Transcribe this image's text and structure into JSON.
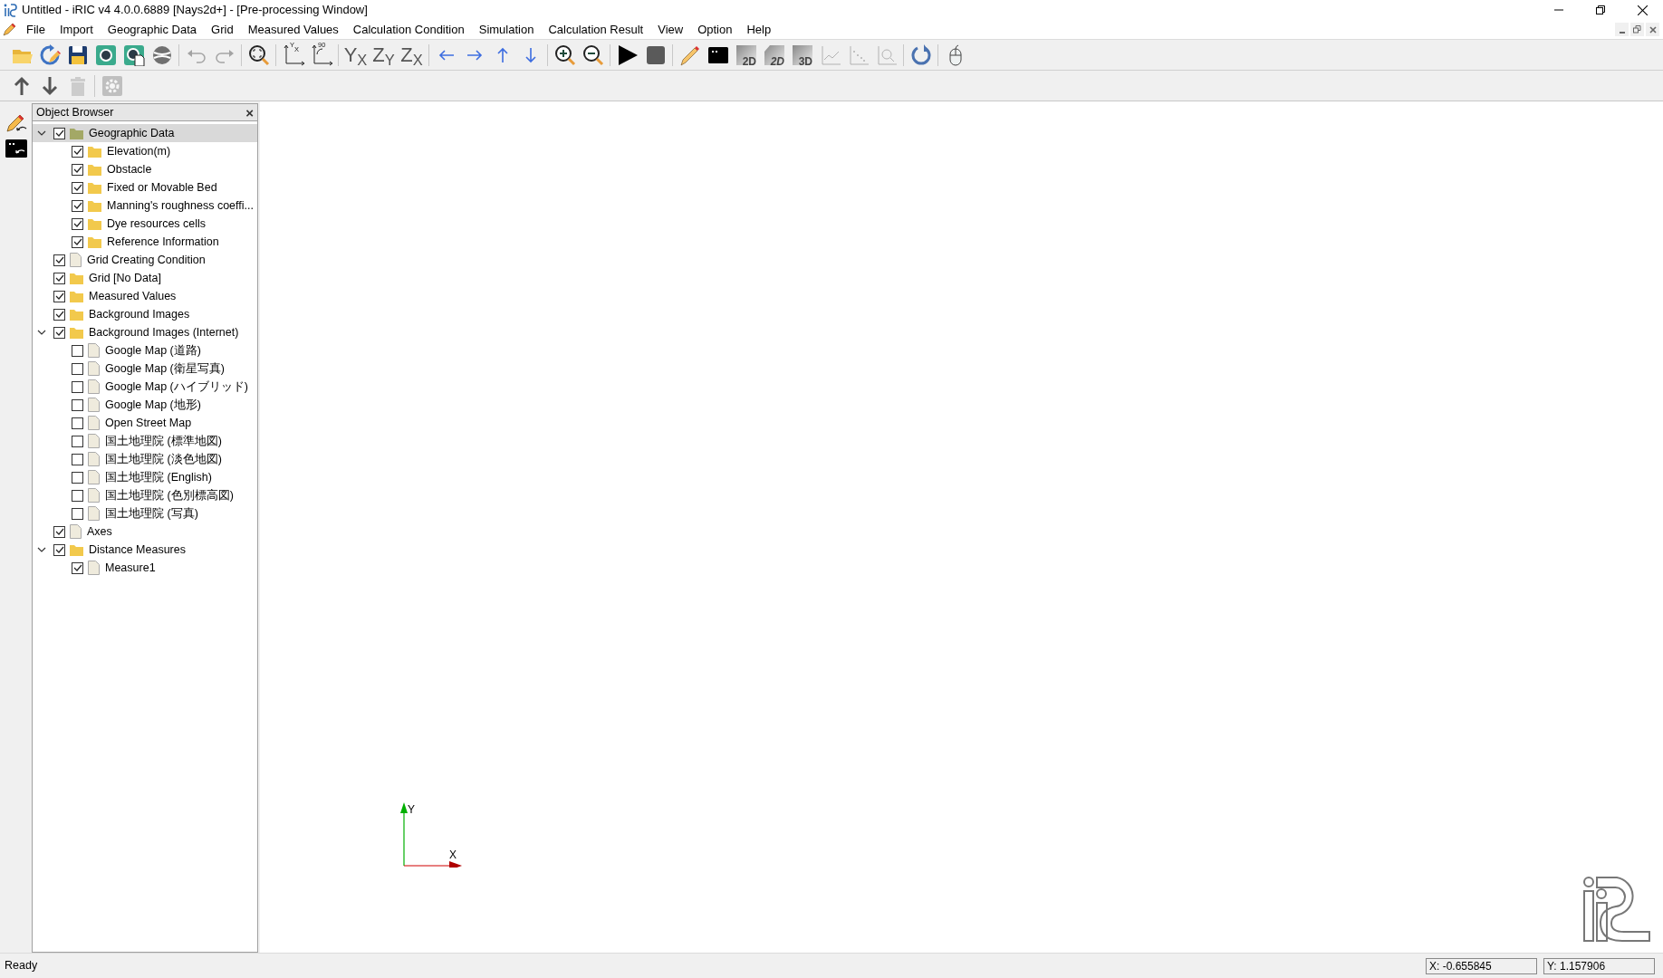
{
  "window": {
    "title": "Untitled - iRIC v4 4.0.0.6889 [Nays2d+] - [Pre-processing Window]"
  },
  "menu": [
    "File",
    "Import",
    "Geographic Data",
    "Grid",
    "Measured Values",
    "Calculation Condition",
    "Simulation",
    "Calculation Result",
    "View",
    "Option",
    "Help"
  ],
  "toolbar_1": [
    {
      "kind": "open",
      "disabled": false
    },
    {
      "kind": "reload",
      "disabled": false
    },
    {
      "kind": "save",
      "disabled": false
    },
    {
      "kind": "snapshot",
      "disabled": false
    },
    {
      "kind": "snapshot-copy",
      "disabled": false
    },
    {
      "kind": "globe",
      "disabled": false
    },
    {
      "kind": "separator"
    },
    {
      "kind": "undo",
      "disabled": true
    },
    {
      "kind": "redo",
      "disabled": true
    },
    {
      "kind": "separator"
    },
    {
      "kind": "zoom-fit",
      "disabled": false
    },
    {
      "kind": "separator"
    },
    {
      "kind": "axes",
      "disabled": false,
      "label": "$^{Y}$$_{X}$"
    },
    {
      "kind": "axes-rotate",
      "disabled": false,
      "label": "$^{90}$"
    },
    {
      "kind": "separator"
    },
    {
      "kind": "view-letters",
      "disabled": false,
      "label": "Y$_{X}$"
    },
    {
      "kind": "view-letters",
      "disabled": false,
      "label": "Z$_{Y}$"
    },
    {
      "kind": "view-letters",
      "disabled": false,
      "label": "Z$_{X}$"
    },
    {
      "kind": "separator"
    },
    {
      "kind": "left",
      "disabled": false
    },
    {
      "kind": "right",
      "disabled": false
    },
    {
      "kind": "up",
      "disabled": false
    },
    {
      "kind": "down",
      "disabled": false
    },
    {
      "kind": "separator"
    },
    {
      "kind": "zoom-in",
      "disabled": false
    },
    {
      "kind": "zoom-out",
      "disabled": false
    },
    {
      "kind": "separator"
    },
    {
      "kind": "play",
      "disabled": false
    },
    {
      "kind": "stop",
      "disabled": false
    },
    {
      "kind": "separator"
    },
    {
      "kind": "pencil",
      "disabled": false
    },
    {
      "kind": "console",
      "disabled": false
    },
    {
      "kind": "tile",
      "disabled": false,
      "label": "2D"
    },
    {
      "kind": "tile-tilted",
      "disabled": false,
      "label": "2D"
    },
    {
      "kind": "tile",
      "disabled": false,
      "label": "3D"
    },
    {
      "kind": "line-graph",
      "disabled": true
    },
    {
      "kind": "scatter-graph",
      "disabled": true
    },
    {
      "kind": "graph-zoom",
      "disabled": true
    },
    {
      "kind": "separator"
    },
    {
      "kind": "rotate",
      "disabled": false
    },
    {
      "kind": "separator"
    },
    {
      "kind": "mouse",
      "disabled": false
    }
  ],
  "toolbar_2": [
    {
      "kind": "move-up",
      "disabled": false
    },
    {
      "kind": "move-down",
      "disabled": false
    },
    {
      "kind": "trash",
      "disabled": true
    },
    {
      "kind": "separator"
    },
    {
      "kind": "gear",
      "disabled": true
    }
  ],
  "object_browser": {
    "title": "Object Browser",
    "close": "×",
    "tree": [
      {
        "label": "Geographic Data",
        "kind": "folder",
        "checked": true,
        "selected": true,
        "expanded": true,
        "children": [
          {
            "label": "Elevation(m)",
            "kind": "folder",
            "checked": true,
            "selected": false
          },
          {
            "label": "Obstacle",
            "kind": "folder",
            "checked": true,
            "selected": false
          },
          {
            "label": "Fixed or Movable Bed",
            "kind": "folder",
            "checked": true,
            "selected": false
          },
          {
            "label": "Manning's roughness coeffi...",
            "kind": "folder",
            "checked": true,
            "selected": false
          },
          {
            "label": "Dye resources cells",
            "kind": "folder",
            "checked": true,
            "selected": false
          },
          {
            "label": "Reference Information",
            "kind": "folder",
            "checked": true,
            "selected": false
          }
        ]
      },
      {
        "label": "Grid Creating Condition",
        "kind": "file",
        "checked": true,
        "selected": false
      },
      {
        "label": "Grid [No Data]",
        "kind": "folder",
        "checked": true,
        "selected": false
      },
      {
        "label": "Measured Values",
        "kind": "folder",
        "checked": true,
        "selected": false
      },
      {
        "label": "Background Images",
        "kind": "folder",
        "checked": true,
        "selected": false
      },
      {
        "label": "Background Images (Internet)",
        "kind": "folder",
        "checked": true,
        "selected": false,
        "expanded": true,
        "children": [
          {
            "label": "Google Map (道路)",
            "kind": "file",
            "checked": false,
            "selected": false
          },
          {
            "label": "Google Map (衛星写真)",
            "kind": "file",
            "checked": false,
            "selected": false
          },
          {
            "label": "Google Map (ハイブリッド)",
            "kind": "file",
            "checked": false,
            "selected": false
          },
          {
            "label": "Google Map (地形)",
            "kind": "file",
            "checked": false,
            "selected": false
          },
          {
            "label": "Open Street Map",
            "kind": "file",
            "checked": false,
            "selected": false
          },
          {
            "label": "国土地理院 (標準地図)",
            "kind": "file",
            "checked": false,
            "selected": false
          },
          {
            "label": "国土地理院 (淡色地図)",
            "kind": "file",
            "checked": false,
            "selected": false
          },
          {
            "label": "国土地理院 (English)",
            "kind": "file",
            "checked": false,
            "selected": false
          },
          {
            "label": "国土地理院 (色別標高図)",
            "kind": "file",
            "checked": false,
            "selected": false
          },
          {
            "label": "国土地理院 (写真)",
            "kind": "file",
            "checked": false,
            "selected": false
          }
        ]
      },
      {
        "label": "Axes",
        "kind": "file",
        "checked": true,
        "selected": false
      },
      {
        "label": "Distance Measures",
        "kind": "folder",
        "checked": true,
        "selected": false,
        "expanded": true,
        "children": [
          {
            "label": "Measure1",
            "kind": "file",
            "checked": true,
            "selected": false
          }
        ]
      }
    ]
  },
  "canvas": {
    "axis_labels": [
      "Y",
      "X"
    ]
  },
  "status_bar": {
    "message": "Ready",
    "x": "X: -0.655845",
    "y": "Y: 1.157906"
  }
}
